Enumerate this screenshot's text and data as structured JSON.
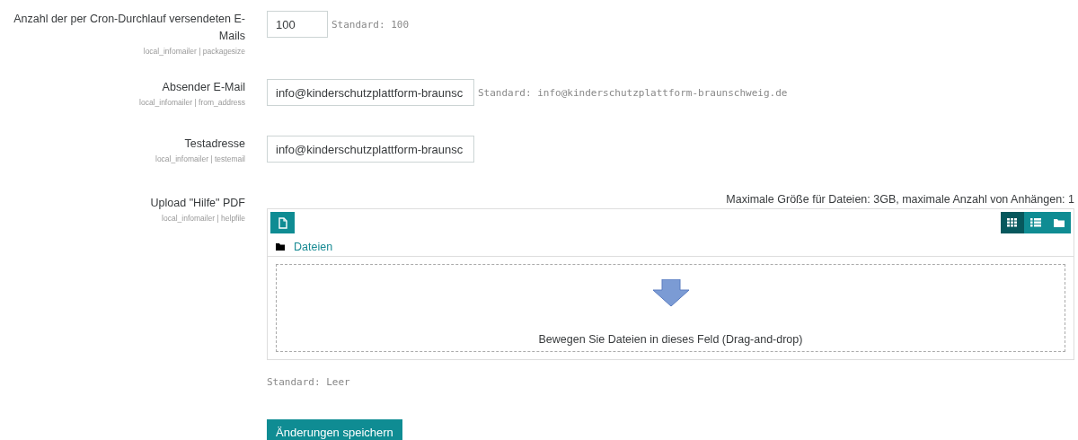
{
  "settings": [
    {
      "kind": "text",
      "label": "Anzahl der per Cron-Durchlauf versendeten E-Mails",
      "setting_name": "local_infomailer | packagesize",
      "value": "100",
      "default": "Standard: 100"
    },
    {
      "kind": "text",
      "label": "Absender E-Mail",
      "setting_name": "local_infomailer | from_address",
      "value": "info@kinderschutzplattform-braunsc",
      "default": "Standard: info@kinderschutzplattform-braunschweig.de"
    },
    {
      "kind": "text",
      "label": "Testadresse",
      "setting_name": "local_infomailer | testemail",
      "value": "info@kinderschutzplattform-braunsc"
    },
    {
      "kind": "file",
      "label": "Upload \"Hilfe\" PDF",
      "setting_name": "local_infomailer | helpfile",
      "limits": "Maximale Größe für Dateien: 3GB, maximale Anzahl von Anhängen: 1",
      "path": "Dateien",
      "views": [
        {
          "kind": "grid",
          "selected": true
        },
        {
          "kind": "list",
          "selected": false
        },
        {
          "kind": "tree",
          "selected": false
        }
      ],
      "drop_hint": "Bewegen Sie Dateien in dieses Feld (Drag-and-drop)",
      "default": "Standard: Leer"
    }
  ],
  "save_button": "Änderungen speichern"
}
